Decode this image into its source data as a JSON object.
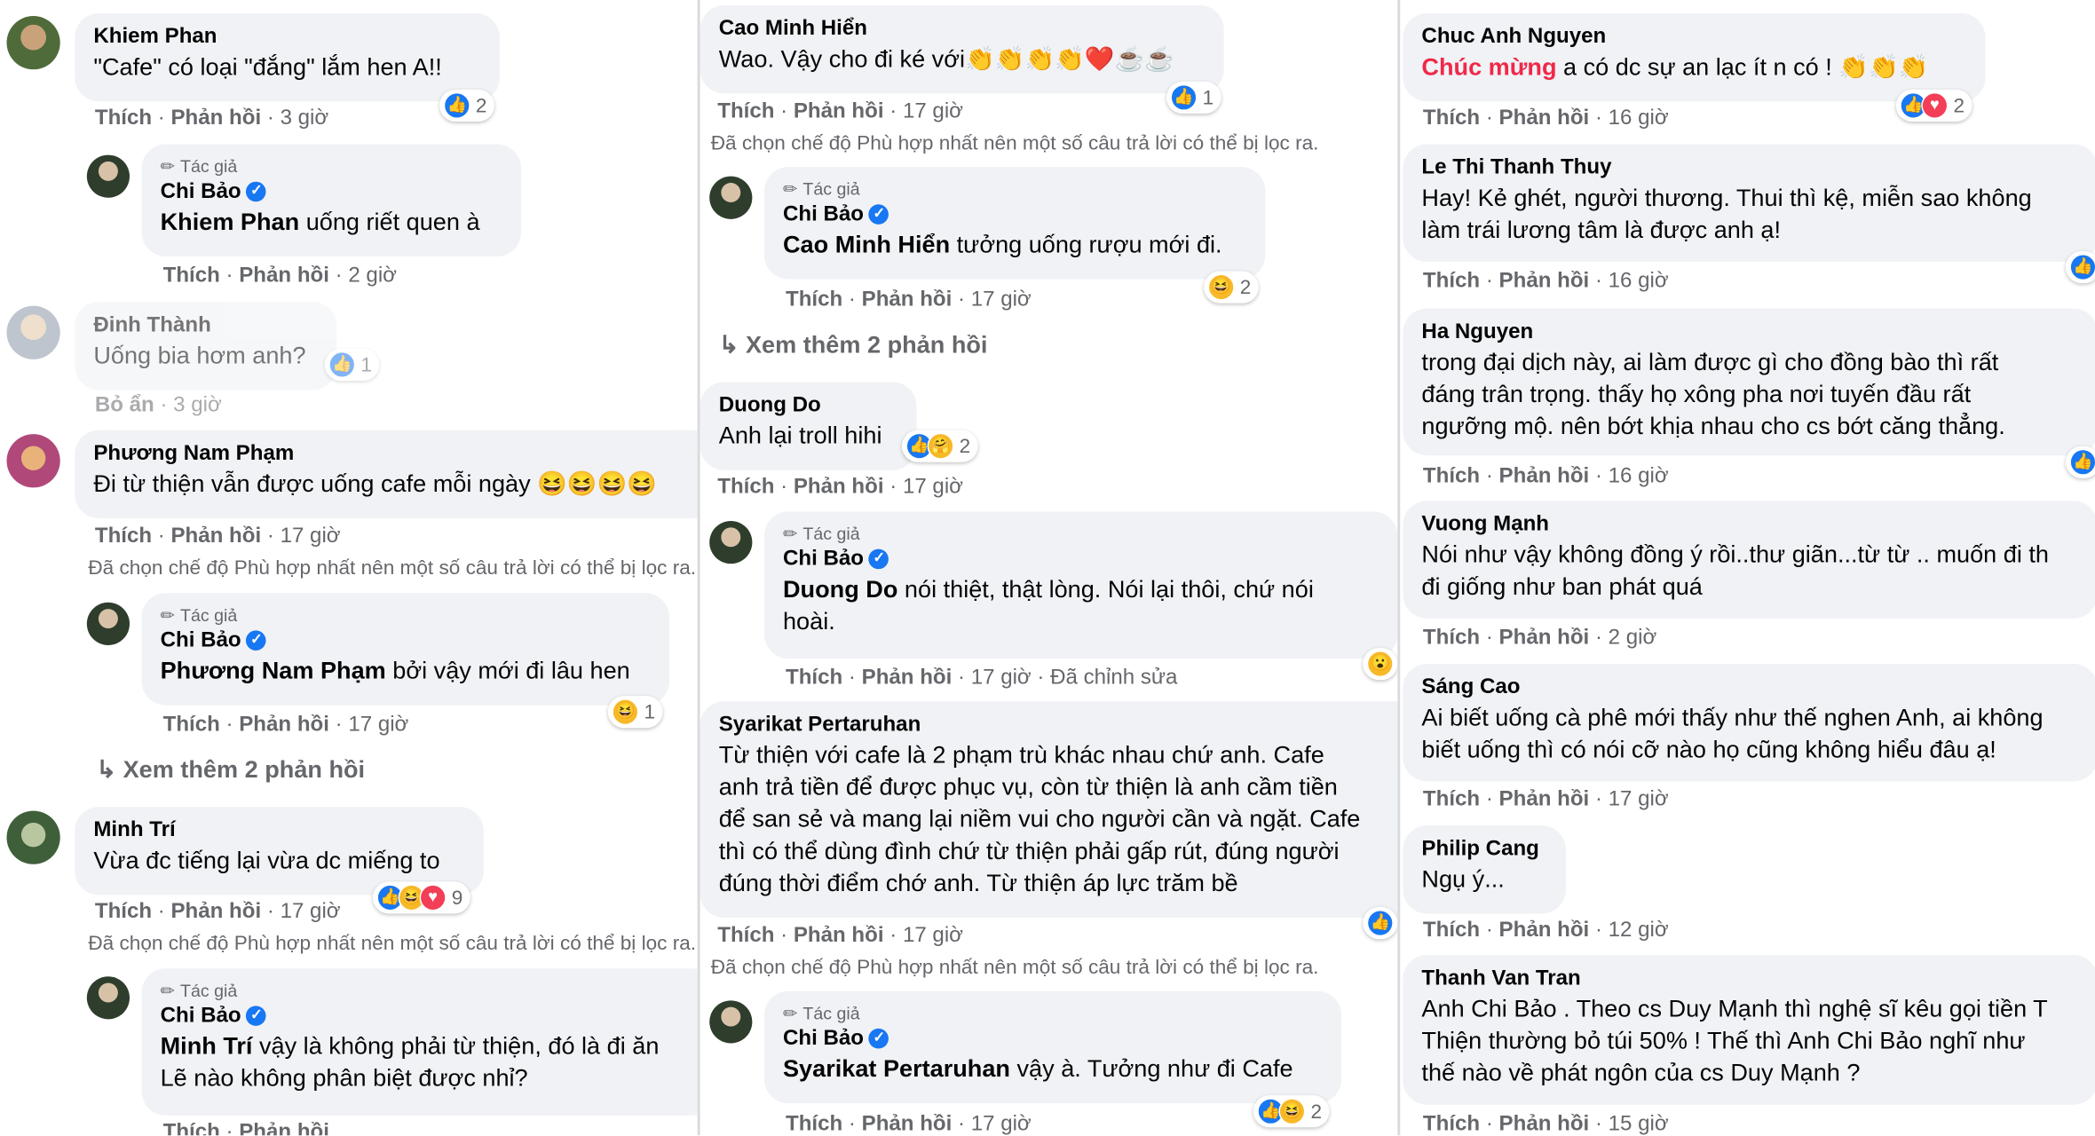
{
  "actions": {
    "like": "Thích",
    "reply": "Phản hồi",
    "hide": "Bỏ ẩn",
    "edited": "Đã chỉnh sửa"
  },
  "author_tag": "Tác giả",
  "filter_notice": "Đã chọn chế độ Phù hợp nhất nên một số câu trả lời có thể bị lọc ra.",
  "view_more": "Xem thêm 2 phản hồi",
  "col1": {
    "c1": {
      "name": "Khiem Phan",
      "text": "\"Cafe\" có loại \"đắng\" lắm hen A!!",
      "time": "3 giờ",
      "reactions": "2"
    },
    "r1": {
      "name": "Chi Bảo",
      "mention": "Khiem Phan",
      "text": " uống riết quen à",
      "time": "2 giờ"
    },
    "c2": {
      "name": "Đinh Thành",
      "text": "Uống bia hơm anh?",
      "time": "3 giờ",
      "reactions": "1"
    },
    "c3": {
      "name": "Phương Nam Phạm",
      "text": "Đi từ thiện vẫn được uống cafe mỗi ngày 😆😆😆😆",
      "time": "17 giờ"
    },
    "r3": {
      "name": "Chi Bảo",
      "mention": "Phương Nam Phạm",
      "text": " bởi vậy mới đi lâu hen",
      "time": "17 giờ",
      "reactions": "1"
    },
    "c4": {
      "name": "Minh Trí",
      "text": "Vừa đc tiếng lại vừa dc miếng to",
      "time": "17 giờ",
      "reactions": "9"
    },
    "r4": {
      "name": "Chi Bảo",
      "mention": "Minh Trí",
      "text": " vậy là không phải từ thiện, đó là đi ăn",
      "text2": "Lẽ nào không phân biệt được nhỉ?"
    }
  },
  "col2": {
    "c1": {
      "name": "Cao Minh Hiển",
      "text": "Wao. Vậy cho đi ké với👏👏👏👏❤️☕☕",
      "time": "17 giờ",
      "reactions": "1"
    },
    "r1": {
      "name": "Chi Bảo",
      "mention": "Cao Minh Hiển",
      "text": " tưởng uống rượu mới đi.",
      "time": "17 giờ",
      "reactions": "2"
    },
    "c2": {
      "name": "Duong Do",
      "text": "Anh lại troll hihi",
      "time": "17 giờ",
      "reactions": "2"
    },
    "r2": {
      "name": "Chi Bảo",
      "mention": "Duong Do",
      "text": " nói thiệt, thật lòng. Nói lại thôi, chứ nói",
      "text2": "hoài.",
      "time": "17 giờ"
    },
    "c3": {
      "name": "Syarikat Pertaruhan",
      "lines": [
        "Từ thiện với cafe là 2 phạm trù khác nhau chứ anh. Cafe",
        "anh trả tiền để được phục vụ, còn từ thiện là anh cầm tiền",
        "để san sẻ và mang lại niềm vui cho người cần và ngặt. Cafe",
        "thì có thể dùng đình chứ từ thiện phải gấp rút, đúng người",
        "đúng thời điểm chớ anh. Từ thiện áp lực trăm bề"
      ],
      "time": "17 giờ"
    },
    "r3": {
      "name": "Chi Bảo",
      "mention": "Syarikat Pertaruhan",
      "text": " vậy à. Tưởng như đi Cafe",
      "time": "17 giờ",
      "reactions": "2"
    }
  },
  "col3": {
    "c1": {
      "name": "Chuc Anh Nguyen",
      "highlight": "Chúc mừng",
      "text": " a có dc sự an lạc ít n có ! 👏👏👏",
      "time": "16 giờ",
      "reactions": "2"
    },
    "c2": {
      "name": "Le Thi Thanh Thuy",
      "lines": [
        "Hay! Kẻ ghét, người thương. Thui thì kệ, miễn sao không",
        "làm trái lương tâm là được anh ạ!"
      ],
      "time": "16 giờ"
    },
    "c3": {
      "name": "Ha Nguyen",
      "lines": [
        "trong đại dịch này, ai làm được gì cho đồng bào thì rất",
        "đáng trân trọng. thấy họ xông pha nơi tuyến đầu rất",
        "ngưỡng mộ. nên bớt khịa nhau cho cs bớt căng thẳng."
      ],
      "time": "16 giờ"
    },
    "c4": {
      "name": "Vuong Mạnh",
      "lines": [
        "Nói như vậy không đồng ý rồi..thư giãn...từ từ .. muốn đi th",
        "đi giống như ban phát quá"
      ],
      "time": "2 giờ"
    },
    "c5": {
      "name": "Sáng Cao",
      "lines": [
        "Ai biết uống cà phê mới thấy như thế nghen Anh, ai không",
        "biết uống thì có nói cỡ nào họ cũng không hiểu đâu ạ!"
      ],
      "time": "17 giờ"
    },
    "c6": {
      "name": "Philip Cang",
      "text": "Ngụ ý...",
      "time": "12 giờ"
    },
    "c7": {
      "name": "Thanh Van Tran",
      "lines": [
        "Anh Chi Bảo . Theo cs Duy Mạnh thì nghệ sĩ kêu gọi tiền T",
        "Thiện thường bỏ túi 50% ! Thế thì Anh Chi Bảo nghĩ như",
        "thế nào về phát ngôn của cs Duy Mạnh ?"
      ],
      "time": "15 giờ"
    }
  },
  "colors": {
    "bubble": "#f0f2f5",
    "meta": "#65676b",
    "like": "#1877f2",
    "highlight": "#f02849"
  }
}
